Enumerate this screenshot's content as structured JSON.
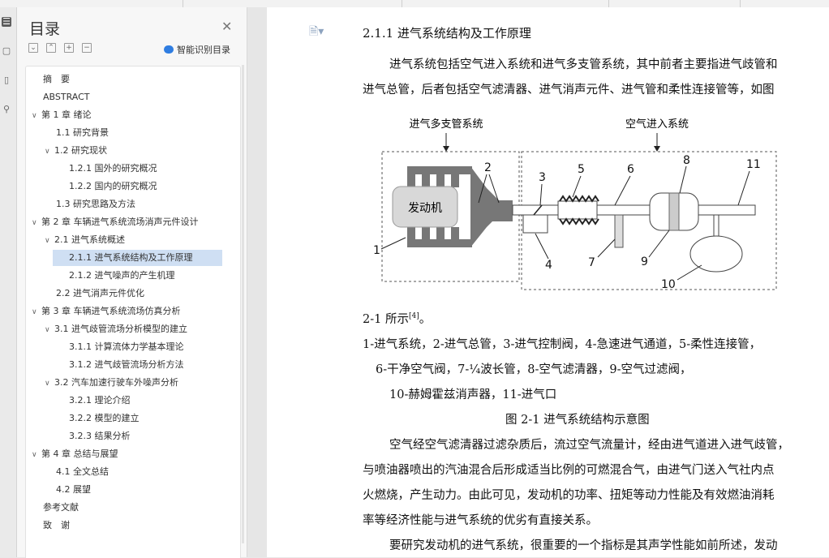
{
  "toc_panel": {
    "title": "目录",
    "smart_label": "智能识别目录",
    "items": [
      {
        "label": "摘　要",
        "level": 0,
        "arrow": ""
      },
      {
        "label": "ABSTRACT",
        "level": 0,
        "arrow": ""
      },
      {
        "label": "第 1 章  绪论",
        "level": 0,
        "arrow": "v"
      },
      {
        "label": "1.1 研究背景",
        "level": 1,
        "arrow": ""
      },
      {
        "label": "1.2 研究现状",
        "level": 1,
        "arrow": "v"
      },
      {
        "label": "1.2.1 国外的研究概况",
        "level": 2,
        "arrow": ""
      },
      {
        "label": "1.2.2 国内的研究概况",
        "level": 2,
        "arrow": ""
      },
      {
        "label": "1.3 研究思路及方法",
        "level": 1,
        "arrow": ""
      },
      {
        "label": "第 2 章  车辆进气系统流场消声元件设计",
        "level": 0,
        "arrow": "v"
      },
      {
        "label": "2.1 进气系统概述",
        "level": 1,
        "arrow": "v"
      },
      {
        "label": "2.1.1 进气系统结构及工作原理",
        "level": 2,
        "arrow": "",
        "selected": true
      },
      {
        "label": "2.1.2 进气噪声的产生机理",
        "level": 2,
        "arrow": ""
      },
      {
        "label": "2.2 进气消声元件优化",
        "level": 1,
        "arrow": ""
      },
      {
        "label": "第 3 章  车辆进气系统流场仿真分析",
        "level": 0,
        "arrow": "v"
      },
      {
        "label": "3.1 进气歧管流场分析模型的建立",
        "level": 1,
        "arrow": "v"
      },
      {
        "label": "3.1.1 计算流体力学基本理论",
        "level": 2,
        "arrow": ""
      },
      {
        "label": "3.1.2 进气歧管流场分析方法",
        "level": 2,
        "arrow": ""
      },
      {
        "label": "3.2 汽车加速行驶车外噪声分析",
        "level": 1,
        "arrow": "v"
      },
      {
        "label": "3.2.1 理论介绍",
        "level": 2,
        "arrow": ""
      },
      {
        "label": "3.2.2 模型的建立",
        "level": 2,
        "arrow": ""
      },
      {
        "label": "3.2.3 结果分析",
        "level": 2,
        "arrow": ""
      },
      {
        "label": "第 4 章  总结与展望",
        "level": 0,
        "arrow": "v"
      },
      {
        "label": "4.1 全文总结",
        "level": 1,
        "arrow": ""
      },
      {
        "label": "4.2 展望",
        "level": 1,
        "arrow": ""
      },
      {
        "label": "参考文献",
        "level": 0,
        "arrow": ""
      },
      {
        "label": "致　谢",
        "level": 0,
        "arrow": ""
      }
    ]
  },
  "document": {
    "heading": "2.1.1 进气系统结构及工作原理",
    "para1_line1": "进气系统包括空气进入系统和进气多支管系统，其中前者主要指进气歧管和",
    "para1_line2": "进气总管，后者包括空气滤清器、进气消声元件、进气管和柔性连接管等，如图",
    "para1_line3_text": "2-1 所示",
    "para1_line3_sup": "[4]",
    "para1_line3_end": "。",
    "legend_line1": "1-进气系统，2-进气总管，3-进气控制阀，4-急速进气通道，5-柔性连接管，",
    "legend_line2": "6-干净空气阀，7-¼波长管，8-空气滤清器，9-空气过滤阀，",
    "legend_line3": "10-赫姆霍兹消声器，11-进气口",
    "caption": "图 2-1 进气系统结构示意图",
    "para2_line1": "空气经空气滤清器过滤杂质后，流过空气流量计，经由进气道进入进气歧管，",
    "para2_line2": "与喷油器喷出的汽油混合后形成适当比例的可燃混合气，由进气门送入气社内点",
    "para2_line3": "火燃烧，产生动力。由此可见，发动机的功率、扭矩等动力性能及有效燃油消耗",
    "para2_line4": "率等经济性能与进气系统的优劣有直接关系。",
    "para3_line1": "要研究发动机的进气系统，很重要的一个指标是其声学性能如前所述，发动"
  },
  "figure": {
    "label_left": "进气多支管系统",
    "label_right": "空气进入系统",
    "engine": "发动机",
    "nums": [
      "1",
      "2",
      "3",
      "4",
      "5",
      "6",
      "7",
      "8",
      "9",
      "10",
      "11"
    ]
  }
}
